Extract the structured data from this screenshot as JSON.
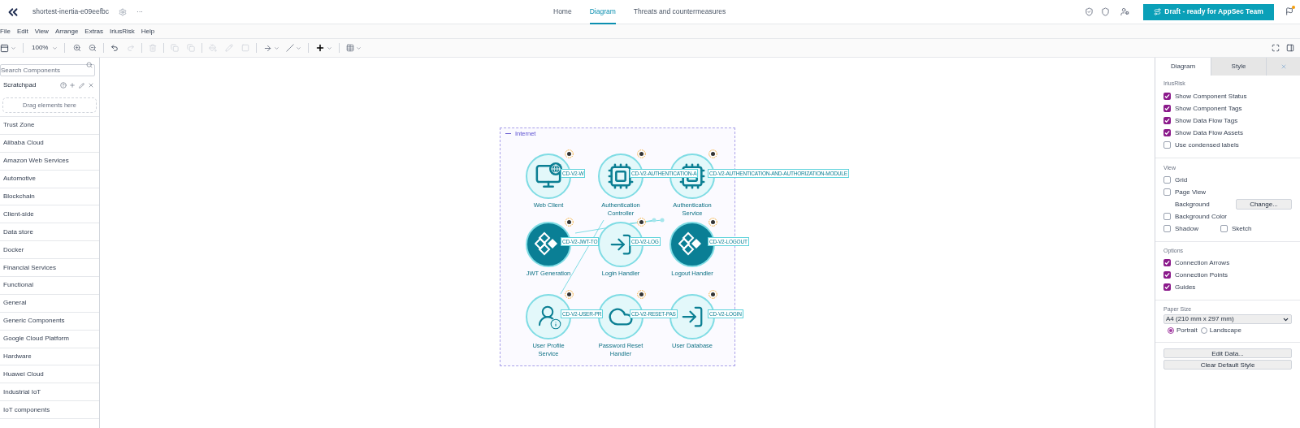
{
  "header": {
    "title": "shortest-inertia-e09eefbc",
    "more": "···",
    "nav": [
      {
        "label": "Home",
        "selected": false
      },
      {
        "label": "Diagram",
        "selected": true
      },
      {
        "label": "Threats and countermeasures",
        "selected": false
      }
    ],
    "status_button": "Draft - ready for AppSec Team",
    "notification": true
  },
  "menu": [
    "File",
    "Edit",
    "View",
    "Arrange",
    "Extras",
    "IriusRisk",
    "Help"
  ],
  "toolbar": {
    "zoom": "100%"
  },
  "sidebar": {
    "search_placeholder": "Search Components",
    "scratchpad": "Scratchpad",
    "drop_hint": "Drag elements here",
    "categories": [
      "Trust Zone",
      "Alibaba Cloud",
      "Amazon Web Services",
      "Automotive",
      "Blockchain",
      "Client-side",
      "Data store",
      "Docker",
      "Financial Services",
      "Functional",
      "General",
      "Generic Components",
      "Google Cloud Platform",
      "Hardware",
      "Huawei Cloud",
      "Industrial IoT",
      "IoT components"
    ]
  },
  "diagram": {
    "trust_zone": "Internet",
    "nodes": [
      {
        "label": "Web Client",
        "tag": "CD-V2-W",
        "kind": "monitor",
        "dark": false
      },
      {
        "label": "Authentication Controller",
        "tag": "CD-V2-AUTHENTICATION-A",
        "kind": "chip",
        "dark": false
      },
      {
        "label": "Authentication Service",
        "tag": "CD-V2-AUTHENTICATION-AND-AUTHORIZATION-MODULE",
        "kind": "chip",
        "dark": false
      },
      {
        "label": "JWT Generation",
        "tag": "CD-V2-JWT-TO",
        "kind": "diamonds",
        "dark": true
      },
      {
        "label": "Login Handler",
        "tag": "CD-V2-LOG",
        "kind": "door",
        "dark": false
      },
      {
        "label": "Logout Handler",
        "tag": "CD-V2-LOGOUT",
        "kind": "diamonds",
        "dark": true
      },
      {
        "label": "User Profile Service",
        "tag": "CD-V2-USER-PR",
        "kind": "user",
        "dark": false
      },
      {
        "label": "Password Reset Handler",
        "tag": "CD-V2-RESET-PAS",
        "kind": "cloud",
        "dark": false
      },
      {
        "label": "User Database",
        "tag": "CD-V2-LOGIN",
        "kind": "door",
        "dark": false
      }
    ]
  },
  "panel": {
    "tabs": [
      {
        "label": "Diagram",
        "selected": true
      },
      {
        "label": "Style",
        "selected": false
      }
    ],
    "irius": {
      "title": "IriusRisk",
      "options": [
        {
          "label": "Show Component Status",
          "checked": true
        },
        {
          "label": "Show Component Tags",
          "checked": true
        },
        {
          "label": "Show Data Flow Tags",
          "checked": true
        },
        {
          "label": "Show Data Flow Assets",
          "checked": true
        },
        {
          "label": "Use condensed labels",
          "checked": false
        }
      ]
    },
    "view": {
      "title": "View",
      "grid": {
        "label": "Grid",
        "checked": false
      },
      "page_view": {
        "label": "Page View",
        "checked": false
      },
      "background": {
        "label": "Background",
        "button": "Change..."
      },
      "background_color": {
        "label": "Background Color",
        "checked": false
      },
      "shadow": {
        "label": "Shadow",
        "checked": false
      },
      "sketch": {
        "label": "Sketch",
        "checked": false
      }
    },
    "options": {
      "title": "Options",
      "options": [
        {
          "label": "Connection Arrows",
          "checked": true
        },
        {
          "label": "Connection Points",
          "checked": true
        },
        {
          "label": "Guides",
          "checked": true
        }
      ]
    },
    "paper": {
      "title": "Paper Size",
      "value": "A4 (210 mm x 297 mm)",
      "orientations": [
        {
          "label": "Portrait",
          "selected": true
        },
        {
          "label": "Landscape",
          "selected": false
        }
      ]
    },
    "buttons": [
      "Edit Data...",
      "Clear Default Style"
    ]
  }
}
